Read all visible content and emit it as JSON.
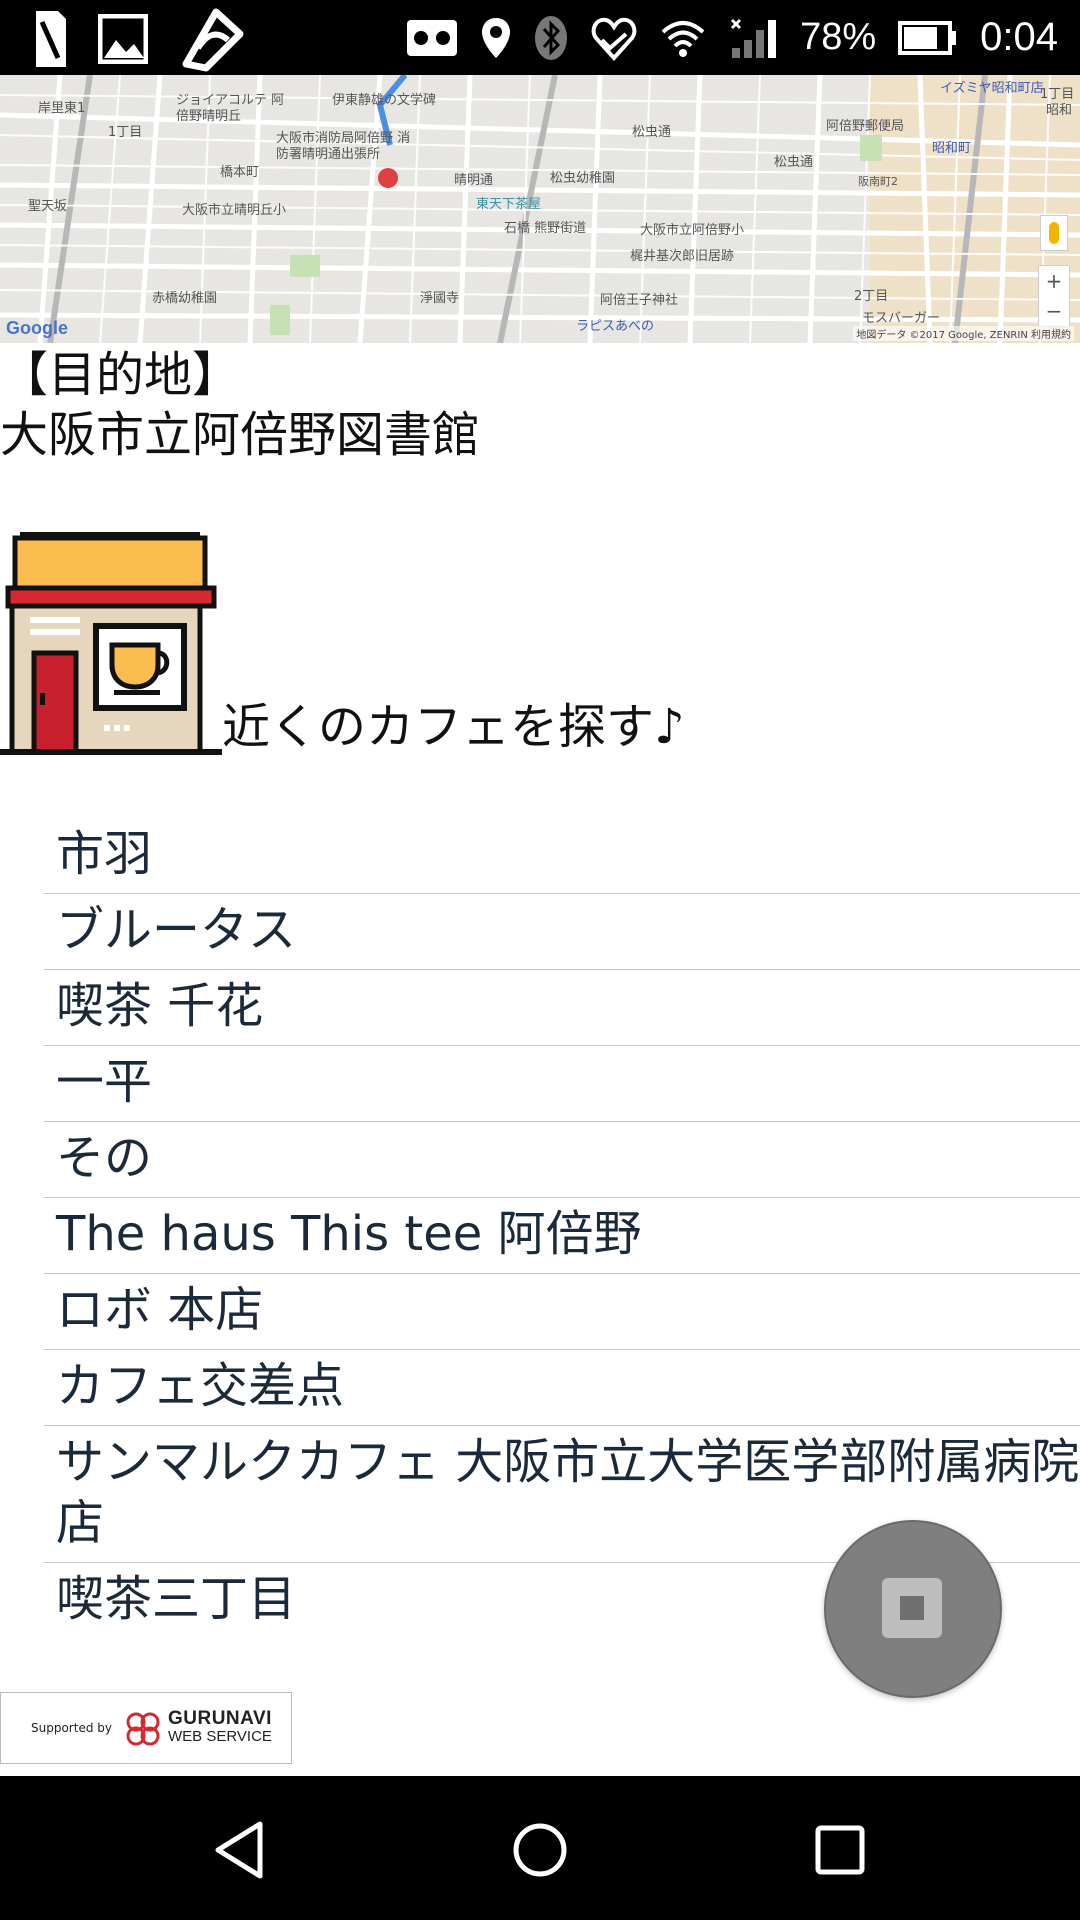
{
  "status_bar": {
    "battery_percent": "78%",
    "battery_level": 0.78,
    "time": "0:04"
  },
  "map": {
    "labels": [
      "岸里東1",
      "ジョイアコルテ 阿倍野晴明丘",
      "伊東静雄の文学碑",
      "イズミヤ昭和町店",
      "1丁目",
      "大阪市消防局阿倍野 消防署晴明通出張所",
      "松虫通",
      "阿倍野郵便局",
      "昭和町",
      "橋本町",
      "晴明通",
      "松虫幼稚園",
      "松虫通",
      "阪南町2",
      "聖天坂",
      "大阪市立晴明丘小",
      "東天下茶屋",
      "石橋 熊野街道",
      "大阪市立阿倍野小",
      "梶井基次郎旧居跡",
      "赤橋幼稚園",
      "淨國寺",
      "阿倍王子神社",
      "2丁目",
      "ラピスあべの",
      "モスバーガー",
      "昭和",
      "1丁目"
    ],
    "logo": "Google",
    "credits": "地図データ ©2017 Google, ZENRIN   利用規約",
    "zoom_in": "+",
    "zoom_out": "−"
  },
  "destination": {
    "label": "【目的地】",
    "name": "大阪市立阿倍野図書館"
  },
  "cafe_search": {
    "text": "近くのカフェを探す♪"
  },
  "cafes": [
    "市羽",
    "ブルータス",
    "喫茶 千花",
    "一平",
    "その",
    "The haus This tee 阿倍野",
    "ロボ 本店",
    "カフェ交差点",
    "サンマルクカフェ 大阪市立大学医学部附属病院店",
    "喫茶三丁目"
  ],
  "gurunavi": {
    "supported_by": "Supported by",
    "brand_line1": "GURUNAVI",
    "brand_line2": "WEB SERVICE"
  },
  "colors": {
    "map_bg": "#e8e6e3",
    "list_text": "#1b2a3a",
    "awning": "#fbbd4f",
    "door": "#c8202f",
    "shop_wall": "#e6d6bd",
    "gurunavi_red": "#d7282f"
  }
}
